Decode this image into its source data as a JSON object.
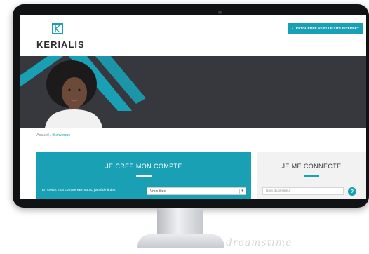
{
  "brand": {
    "name": "KERIALIS",
    "accent": "#1aa0b4",
    "dark": "#36383e"
  },
  "header": {
    "back_button_label": "RETOURNER VERS LE SITE INTERNET",
    "back_icon": "chevron-left-icon"
  },
  "breadcrumb": {
    "home": "Accueil",
    "separator": "/",
    "current": "Bienvenue"
  },
  "create_account": {
    "title": "JE CRÉE MON COMPTE",
    "intro": "En créant mon compte KERIALIS, j'accède à des",
    "select_value": "Vous êtes"
  },
  "login": {
    "title": "JE ME CONNECTE",
    "username_placeholder": "Nom d'utilisateur",
    "help_label": "?"
  },
  "watermark": "dreamstime"
}
